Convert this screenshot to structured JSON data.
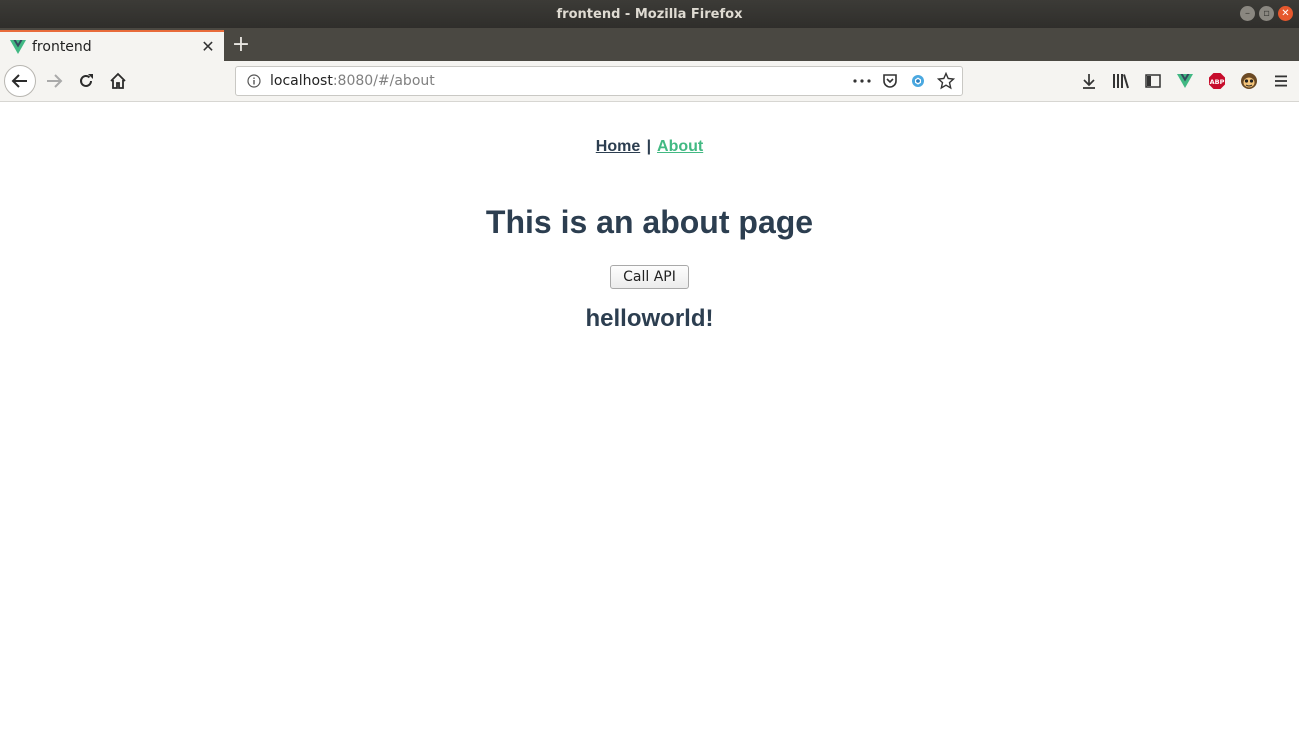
{
  "window": {
    "title": "frontend - Mozilla Firefox"
  },
  "tab": {
    "label": "frontend"
  },
  "urlbar": {
    "host": "localhost",
    "rest": ":8080/#/about"
  },
  "icons": {
    "favicon": "vue-logo-icon",
    "back": "back-arrow-icon",
    "forward": "forward-arrow-icon",
    "reload": "reload-icon",
    "home": "home-icon",
    "info": "info-icon",
    "more": "more-dots-icon",
    "pocket": "pocket-icon",
    "extension": "extension-icon",
    "bookmark": "star-icon",
    "downloads": "download-icon",
    "library": "library-icon",
    "sidebar": "sidebar-icon",
    "vue_devtools": "vue-devtools-icon",
    "adblock": "abp-icon",
    "tampermonkey": "monkey-icon",
    "menu": "hamburger-menu-icon"
  },
  "page": {
    "nav": {
      "home": "Home",
      "separator": "|",
      "about": "About"
    },
    "title": "This is an about page",
    "button": "Call API",
    "result": "helloworld!"
  },
  "colors": {
    "text": "#2c3e50",
    "active_link": "#42b983",
    "tab_accent": "#e86b3a"
  }
}
